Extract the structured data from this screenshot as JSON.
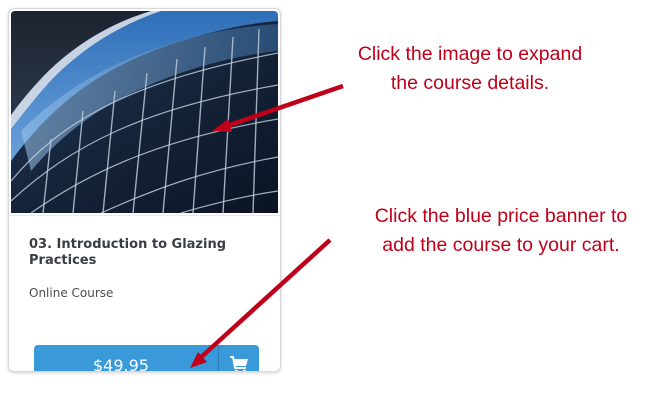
{
  "card": {
    "image_alt": "Curved glass building facade",
    "title": "03. Introduction to Glazing Practices",
    "type": "Online Course",
    "price": "$49.95",
    "cart_icon": "shopping-cart-icon"
  },
  "annotations": {
    "image_note_line1": "Click the image to expand",
    "image_note_line2": "the course details.",
    "price_note_line1": "Click the blue price banner to",
    "price_note_line2": "add the course to your cart."
  },
  "colors": {
    "annotation": "#c0001a",
    "price_banner": "#3a9ad9",
    "arrow": "#c0001a"
  }
}
